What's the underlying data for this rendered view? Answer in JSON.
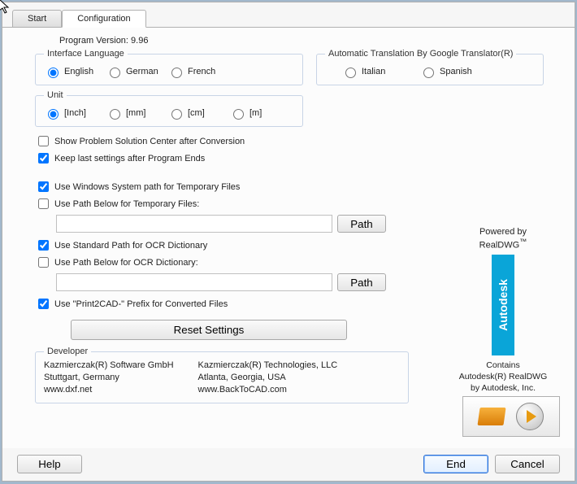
{
  "tabs": {
    "start": "Start",
    "config": "Configuration"
  },
  "version_line": "Program Version: 9.96",
  "group_lang": {
    "legend": "Interface Language",
    "options": {
      "en": "English",
      "de": "German",
      "fr": "French"
    }
  },
  "group_trans": {
    "legend": "Automatic Translation By Google Translator(R)",
    "options": {
      "it": "Italian",
      "es": "Spanish"
    }
  },
  "group_unit": {
    "legend": "Unit",
    "options": {
      "inch": "[Inch]",
      "mm": "[mm]",
      "cm": "[cm]",
      "m": "[m]"
    }
  },
  "checks": {
    "show_problem": "Show Problem Solution Center after Conversion",
    "keep_last": "Keep last settings after Program Ends",
    "use_win_temp": "Use Windows System path for Temporary Files",
    "use_below_temp": "Use Path Below for Temporary Files:",
    "use_std_ocr": "Use Standard Path for OCR Dictionary",
    "use_below_ocr": "Use Path Below for OCR Dictionary:",
    "use_prefix": "Use \"Print2CAD-\" Prefix for Converted Files"
  },
  "btn": {
    "path": "Path",
    "reset": "Reset Settings",
    "help": "Help",
    "end": "End",
    "cancel": "Cancel"
  },
  "developer": {
    "legend": "Developer",
    "col1": {
      "l1": "Kazmierczak(R) Software GmbH",
      "l2": "Stuttgart, Germany",
      "l3": "www.dxf.net"
    },
    "col2": {
      "l1": "Kazmierczak(R) Technologies, LLC",
      "l2": "Atlanta, Georgia, USA",
      "l3": "www.BackToCAD.com"
    }
  },
  "powered": {
    "l1": "Powered by",
    "l2": "RealDWG",
    "tm": "™",
    "badge": "Autodesk"
  },
  "contains": {
    "l1": "Contains",
    "l2": "Autodesk(R) RealDWG",
    "l3": "by Autodesk, Inc."
  }
}
